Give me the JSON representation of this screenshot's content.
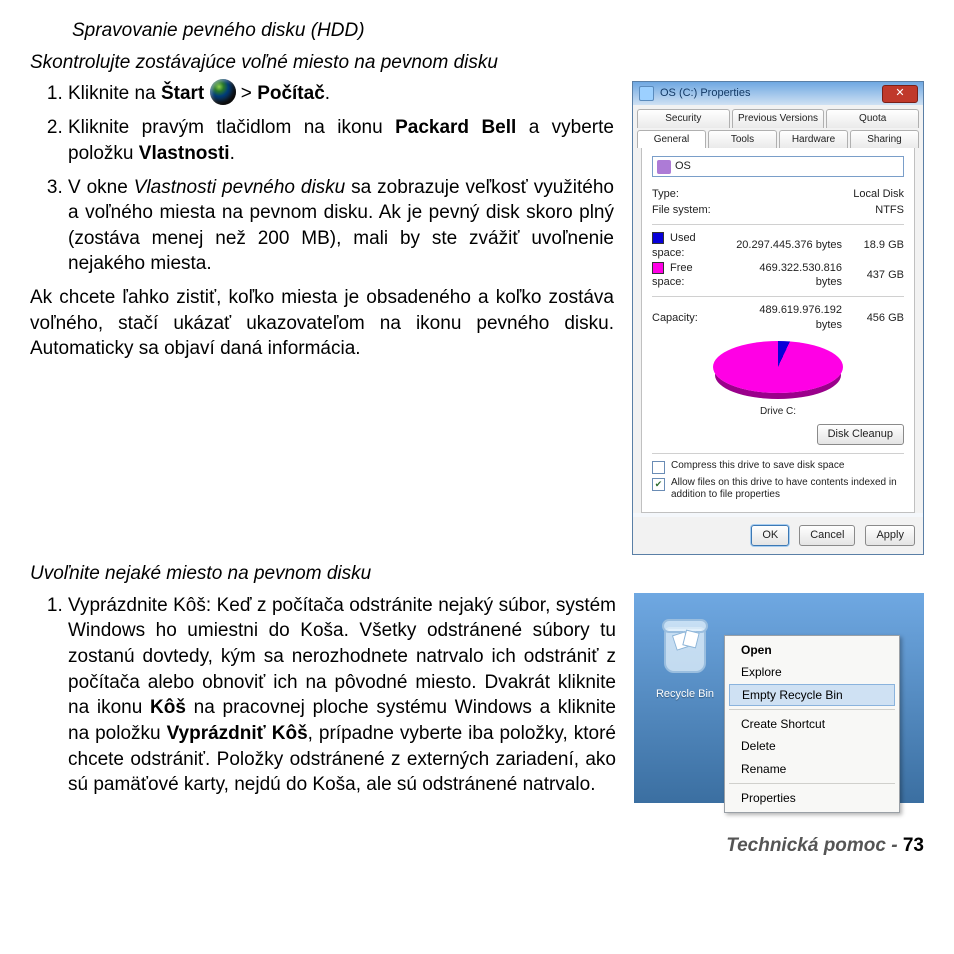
{
  "heading": "Spravovanie pevného disku (HDD)",
  "sub1": "Skontrolujte zostávajúce voľné miesto na pevnom disku",
  "step1": {
    "a": "Kliknite na ",
    "start": "Štart",
    "sep": " > ",
    "pocitac": "Počítač",
    "dot": "."
  },
  "step2": {
    "a": "Kliknite pravým tlačidlom na ikonu ",
    "b": "Packard Bell",
    "c": " a vyberte položku ",
    "d": "Vlastnosti",
    "e": "."
  },
  "step3": {
    "a": "V okne ",
    "it": "Vlastnosti pevného disku",
    "b": " sa zobrazuje veľkosť využitého a voľného miesta na pevnom disku. Ak je pevný disk skoro plný (zostáva menej než 200 MB), mali by ste zvážiť uvoľnenie nejakého miesta."
  },
  "para1": "Ak chcete ľahko zistiť, koľko miesta je obsadeného a koľko zostáva voľného, stačí ukázať ukazovateľom na ikonu pevného disku. Automaticky sa objaví daná informácia.",
  "sub2": "Uvoľnite nejaké miesto na pevnom disku",
  "step_b1": {
    "a": "Vyprázdnite Kôš: Keď z počítača odstránite nejaký súbor, systém Windows ho umiestni do Koša. Všetky odstránené súbory tu zostanú dovtedy, kým sa nerozhodnete natrvalo ich odstrániť z počítača alebo obnoviť ich na pôvodné miesto. Dvakrát kliknite na ikonu ",
    "b": "Kôš",
    "c": " na pracovnej ploche systému Windows a kliknite na položku ",
    "d": "Vyprázdniť Kôš",
    "e": ", prípadne vyberte iba položky, ktoré chcete odstrániť. Položky odstránené z externých zariadení, ako sú pamäťové karty, nejdú do Koša, ale sú odstránené natrvalo."
  },
  "footer": {
    "label": "Technická pomoc -",
    "page": "73"
  },
  "props": {
    "title": "OS (C:) Properties",
    "tabs_top": [
      "Security",
      "Previous Versions",
      "Quota"
    ],
    "tabs_bot": [
      "General",
      "Tools",
      "Hardware",
      "Sharing"
    ],
    "drive_name": "OS",
    "type_l": "Type:",
    "type_v": "Local Disk",
    "fs_l": "File system:",
    "fs_v": "NTFS",
    "used_l": "Used space:",
    "used_b": "20.297.445.376 bytes",
    "used_g": "18.9 GB",
    "free_l": "Free space:",
    "free_b": "469.322.530.816 bytes",
    "free_g": "437 GB",
    "cap_l": "Capacity:",
    "cap_b": "489.619.976.192 bytes",
    "cap_g": "456 GB",
    "drive_label": "Drive C:",
    "cleanup": "Disk Cleanup",
    "chk1": "Compress this drive to save disk space",
    "chk2": "Allow files on this drive to have contents indexed in addition to file properties",
    "ok": "OK",
    "cancel": "Cancel",
    "apply": "Apply"
  },
  "ctx": {
    "bin_label": "Recycle Bin",
    "open": "Open",
    "explore": "Explore",
    "empty": "Empty Recycle Bin",
    "shortcut": "Create Shortcut",
    "delete": "Delete",
    "rename": "Rename",
    "props": "Properties"
  }
}
